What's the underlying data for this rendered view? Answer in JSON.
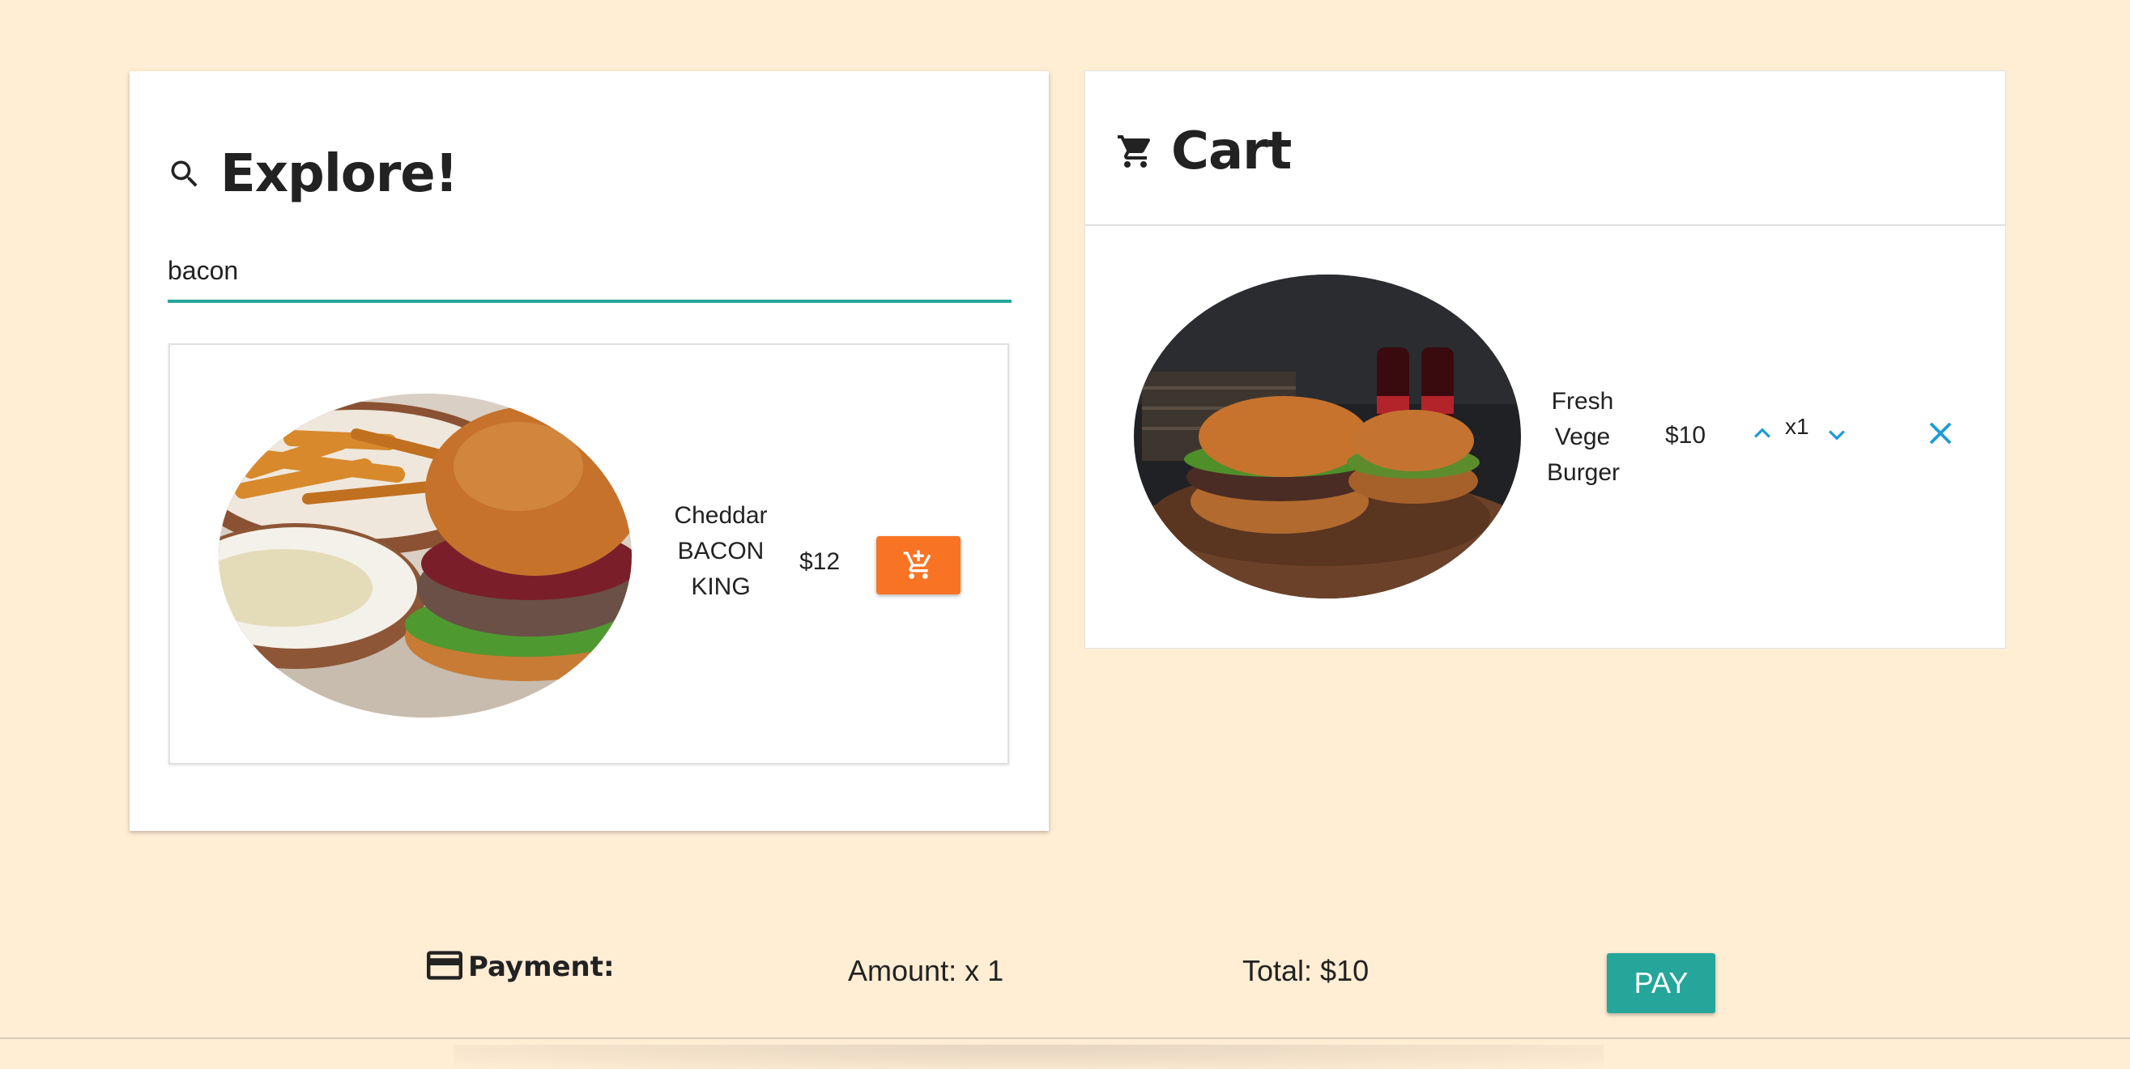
{
  "explore": {
    "title": "Explore!",
    "search_value": "bacon",
    "icon": "search-icon",
    "results": [
      {
        "name_lines": [
          "Cheddar",
          "BACON",
          "KING"
        ],
        "price": "$12",
        "add_icon": "add-shopping-cart-icon",
        "image": "burger-with-fries-photo"
      }
    ]
  },
  "cart": {
    "title": "Cart",
    "icon": "shopping-cart-icon",
    "items": [
      {
        "name_lines": [
          "Fresh",
          "Vege",
          "Burger"
        ],
        "price": "$10",
        "quantity": "x1",
        "image": "two-burgers-with-cola-photo"
      }
    ]
  },
  "payment": {
    "label": "Payment:",
    "icon": "credit-card-icon",
    "amount": "Amount: x 1",
    "total": "Total: $10",
    "pay_label": "PAY"
  },
  "colors": {
    "background": "#ffedd4",
    "accent_teal": "#26a69a",
    "add_button": "#f97325",
    "cart_controls": "#1e9bd7"
  }
}
